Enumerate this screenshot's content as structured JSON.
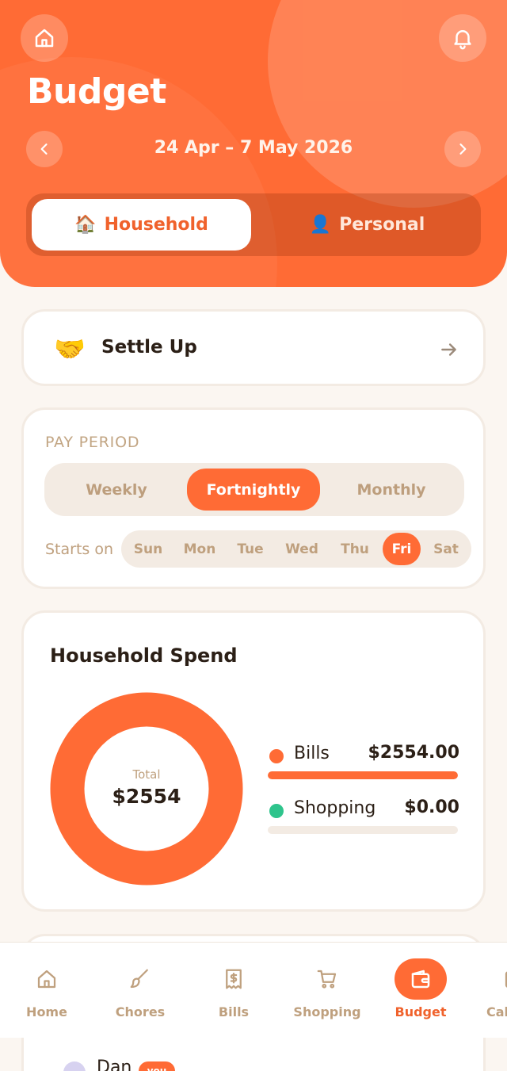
{
  "header": {
    "title": "Budget",
    "date_range": "24 Apr – 7 May 2026",
    "segments": [
      {
        "label": "Household",
        "emoji": "🏠",
        "active": true
      },
      {
        "label": "Personal",
        "emoji": "👤",
        "active": false
      }
    ]
  },
  "settle": {
    "emoji": "🤝",
    "label": "Settle Up"
  },
  "pay_period": {
    "label": "PAY PERIOD",
    "options": [
      "Weekly",
      "Fortnightly",
      "Monthly"
    ],
    "selected": "Fortnightly",
    "starts_on_label": "Starts on",
    "days": [
      "Sun",
      "Mon",
      "Tue",
      "Wed",
      "Thu",
      "Fri",
      "Sat"
    ],
    "selected_day": "Fri"
  },
  "spend": {
    "title": "Household Spend",
    "total_label": "Total",
    "total_value": "$2554",
    "categories": [
      {
        "name": "Bills",
        "value": "$2554.00",
        "share": 1.0,
        "color": "#ff6b35"
      },
      {
        "name": "Shopping",
        "value": "$0.00",
        "share": 0.0,
        "color": "#2ec48c"
      }
    ]
  },
  "member": {
    "name": "Dan",
    "badge": "you"
  },
  "nav": {
    "items": [
      {
        "label": "Home",
        "icon": "home-icon",
        "active": false
      },
      {
        "label": "Chores",
        "icon": "brush-icon",
        "active": false
      },
      {
        "label": "Bills",
        "icon": "receipt-icon",
        "active": false
      },
      {
        "label": "Shopping",
        "icon": "cart-icon",
        "active": false
      },
      {
        "label": "Budget",
        "icon": "wallet-icon",
        "active": true
      },
      {
        "label": "Cal",
        "icon": "calendar-icon",
        "active": false
      }
    ]
  },
  "colors": {
    "accent": "#ff6b35",
    "background": "#fbf6f1",
    "muted_text": "#bfa07e"
  }
}
